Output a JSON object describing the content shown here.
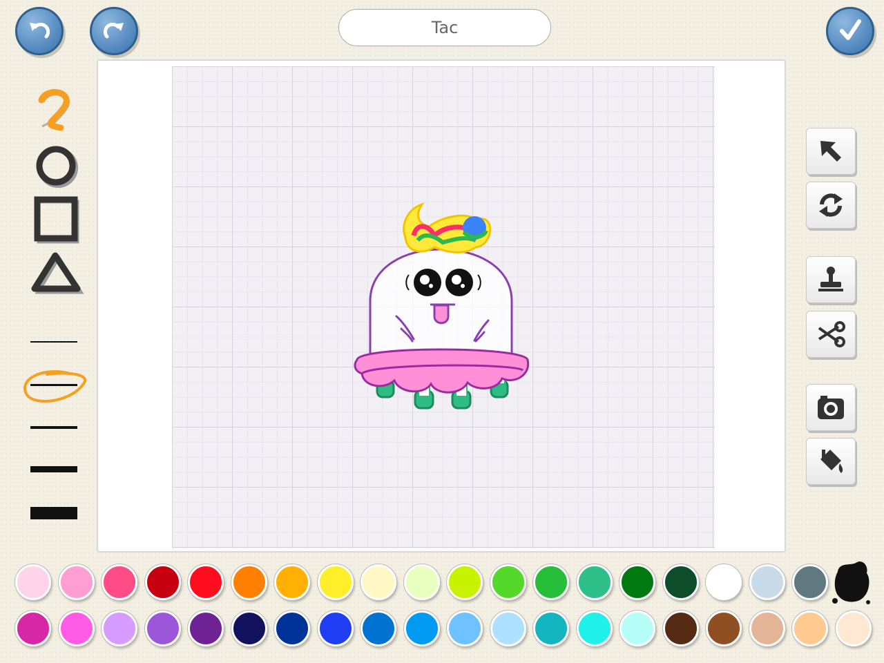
{
  "toolbar": {
    "title_value": "Tac",
    "undo_icon": "undo-icon",
    "redo_icon": "redo-icon",
    "done_icon": "checkmark-icon"
  },
  "left_tools": [
    "freehand-icon",
    "circle-icon",
    "square-icon",
    "triangle-icon"
  ],
  "line_widths": [
    "thin",
    "medium-selected",
    "medium",
    "thick",
    "extra-thick"
  ],
  "right_tools": [
    "pointer-icon",
    "rotate-icon",
    "stamp-icon",
    "scissors-icon",
    "camera-icon",
    "paint-bucket-icon"
  ],
  "palette": {
    "row1": [
      "#ffd3ea",
      "#ff9ed3",
      "#ff4b86",
      "#c60010",
      "#ff0d1f",
      "#ff8000",
      "#ffb000",
      "#ffef2b",
      "#fff8c4",
      "#e9ffc0",
      "#c8f200",
      "#54d92b",
      "#27bf3a",
      "#2fbf89",
      "#007a10",
      "#0d4d2a",
      "#ffffff",
      "#c9dbe8",
      "#607880"
    ],
    "row2": [
      "#d627a6",
      "#ff5be6",
      "#d79cff",
      "#9c56d9",
      "#6f2294",
      "#12125e",
      "#003399",
      "#1f3df2",
      "#0073d1",
      "#009af2",
      "#6ec2ff",
      "#aee0ff",
      "#13b6c0",
      "#1ff0ea",
      "#b6fff8",
      "#552b14",
      "#8f4f22",
      "#e4b497",
      "#ffc990",
      "#ffe8d2"
    ],
    "ink_color": "#111111"
  },
  "canvas": {
    "character": "bald-ghost-with-tutu"
  }
}
